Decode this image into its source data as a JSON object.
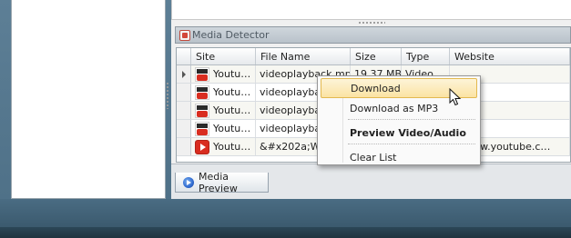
{
  "panel": {
    "title": "Media Detector",
    "title_icon": "app-icon"
  },
  "grid": {
    "columns": [
      "Site",
      "File Name",
      "Size",
      "Type",
      "Website"
    ],
    "rows": [
      {
        "site": "Youtu…",
        "icon": "youtube-text-icon",
        "file": "videoplayback.mp4",
        "size": "19.37 MB",
        "type": "Video",
        "website": ""
      },
      {
        "site": "Youtu…",
        "icon": "youtube-text-icon",
        "file": "videoplayback",
        "size": "",
        "type": "",
        "website": ""
      },
      {
        "site": "Youtu…",
        "icon": "youtube-text-icon",
        "file": "videoplayback",
        "size": "",
        "type": "",
        "website": ""
      },
      {
        "site": "Youtu…",
        "icon": "youtube-text-icon",
        "file": "videoplayback",
        "size": "",
        "type": "",
        "website": ""
      },
      {
        "site": "Youtu…",
        "icon": "youtube-play-icon",
        "file": "&#x202a;Wh…",
        "size": "",
        "type": "",
        "website": "://www.youtube.c…"
      }
    ]
  },
  "context_menu": {
    "items": [
      {
        "label": "Download",
        "state": "hovered"
      },
      {
        "label": "Download as MP3"
      },
      {
        "label": "Preview Video/Audio",
        "style": "bold"
      },
      {
        "label": "Clear List"
      }
    ]
  },
  "tabs": [
    {
      "label": "Media Preview",
      "icon": "media-preview-icon"
    }
  ],
  "colors": {
    "menu_highlight": "#fbe3a3",
    "menu_highlight_border": "#e3b950",
    "youtube_red": "#d92d20"
  }
}
